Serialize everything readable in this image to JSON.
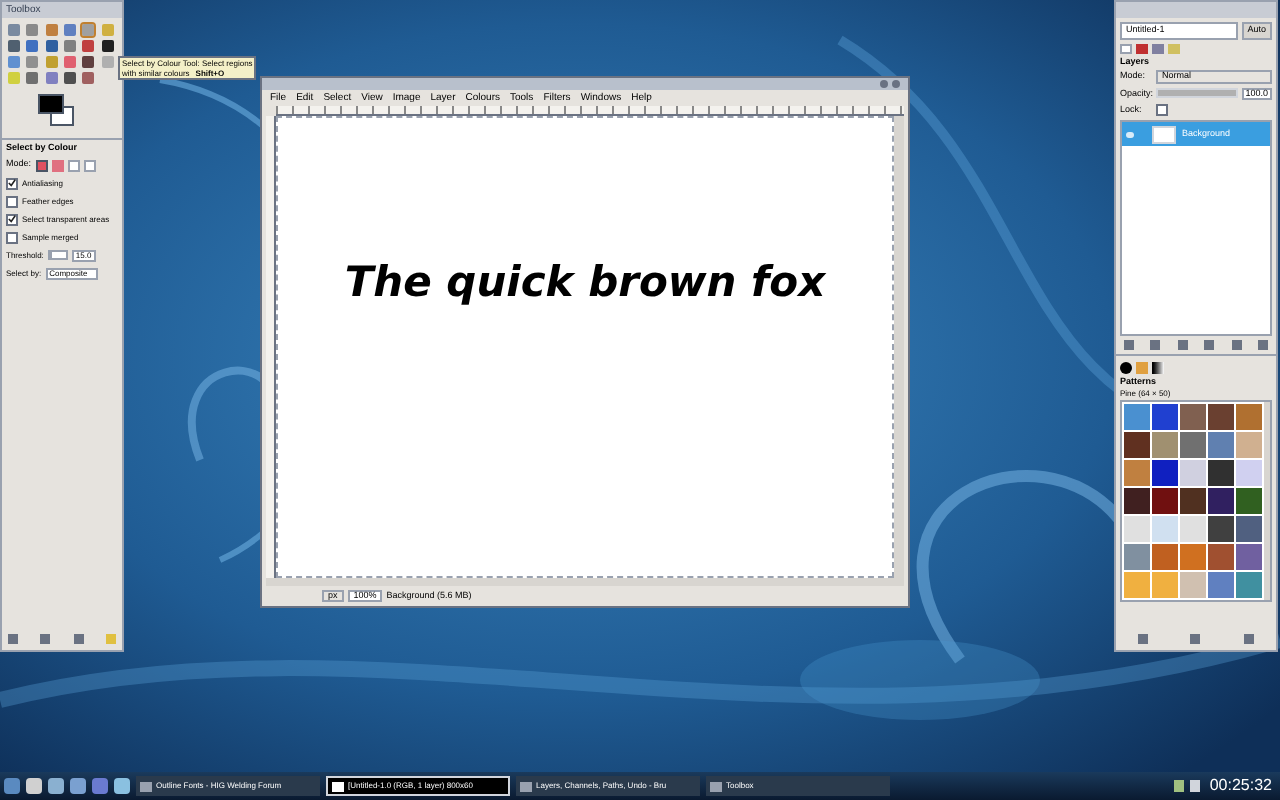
{
  "toolbox": {
    "title": "Toolbox",
    "tooltip": {
      "text": "Select by Colour Tool: Select regions",
      "line2": "with similar colours",
      "shortcut": "Shift+O"
    },
    "tool_options": {
      "title": "Select by Colour",
      "mode_label": "Mode:",
      "options": [
        {
          "label": "Antialiasing",
          "checked": true
        },
        {
          "label": "Feather edges",
          "checked": false
        },
        {
          "label": "Select transparent areas",
          "checked": true
        },
        {
          "label": "Sample merged",
          "checked": false
        }
      ],
      "threshold": {
        "label": "Threshold:",
        "value": "15.0",
        "level": 0.06
      },
      "select_by": {
        "label": "Select by:",
        "value": "Composite"
      }
    }
  },
  "image_window": {
    "menu": [
      "File",
      "Edit",
      "Select",
      "View",
      "Image",
      "Layer",
      "Colours",
      "Tools",
      "Filters",
      "Windows",
      "Help"
    ],
    "canvas_text": "The quick brown fox",
    "status": {
      "unit": "px",
      "zoom": "100%",
      "info": "Background (5.6 MB)"
    }
  },
  "dock": {
    "image_menu": "Untitled-1",
    "auto": "Auto",
    "layers_title": "Layers",
    "mode": {
      "label": "Mode:",
      "value": "Normal"
    },
    "opacity": {
      "label": "Opacity:",
      "value": "100.0",
      "level": 1
    },
    "lock_label": "Lock:",
    "lock_checked": false,
    "layers": [
      {
        "name": "Background",
        "selected": true
      }
    ],
    "patterns_title": "Patterns",
    "pattern_name": "Pine (64 × 50)"
  },
  "taskbar": {
    "tasks": [
      {
        "label": "Outline Fonts - HIG Welding Forum",
        "selected": false
      },
      {
        "label": "[Untitled-1.0 (RGB, 1 layer) 800x60",
        "selected": true
      },
      {
        "label": "Layers, Channels, Paths, Undo - Bru",
        "selected": false
      },
      {
        "label": "Toolbox",
        "selected": false
      }
    ],
    "clock": "00:25:32"
  }
}
